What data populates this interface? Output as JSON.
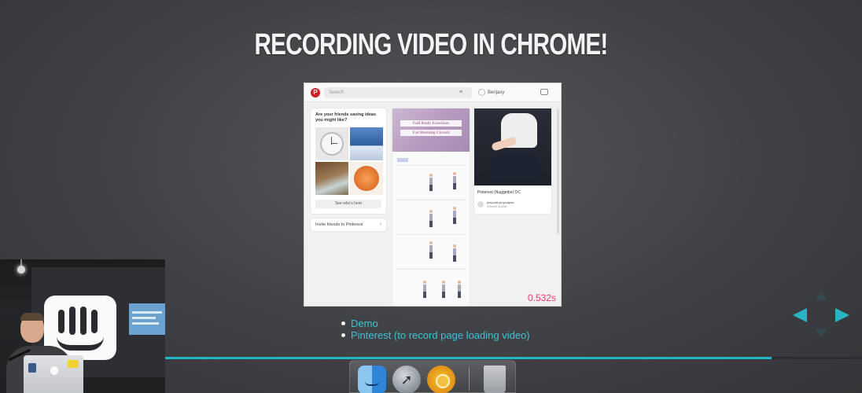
{
  "slide": {
    "title": "RECORDING VIDEO IN CHROME!",
    "bullets": [
      "Demo",
      "Pinterest (to record page loading video)"
    ],
    "progress_fraction": 0.87
  },
  "screenshot": {
    "app": "Pinterest",
    "search_placeholder": "Search",
    "menu_icon": "≡",
    "user_name": "Benjaxy",
    "suggest_card": {
      "question": "Are your friends saving ideas you might like?",
      "button": "See who's here"
    },
    "invite_card": {
      "label": "Invite friends to Pinterest",
      "arrow": "›"
    },
    "fitness_pin": {
      "line1": "Full Body Exercises",
      "line2": "Fat Burning Circuit"
    },
    "fashion_pin": {
      "caption": "Pinterest (Nuggetbe) OC",
      "user": "pinyoutt pinyoutpan",
      "sub": "Kittened Subtitle"
    },
    "timer": "0.532s"
  },
  "nav": {
    "prev_icon": "left-arrow-icon",
    "next_icon": "right-arrow-icon"
  },
  "dock": {
    "items": [
      "finder-icon",
      "launchpad-icon",
      "chrome-canary-icon",
      "trash-icon"
    ]
  },
  "colors": {
    "accent": "#28b6c4",
    "timer": "#e5396e",
    "bullet_text": "#3cc4d4"
  }
}
